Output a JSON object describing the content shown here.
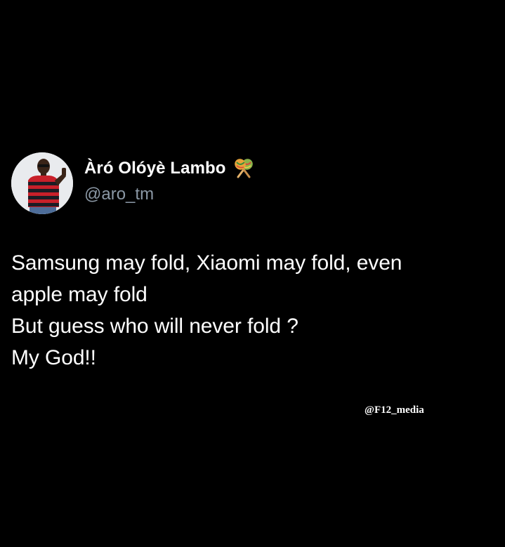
{
  "tweet": {
    "display_name": "Àró Olóyè Lambo",
    "name_emoji": "maracas-icon",
    "handle": "@aro_tm",
    "lines": [
      "Samsung may fold, Xiaomi may fold, even",
      "apple may fold",
      "But guess who will never fold ?",
      "My God!!"
    ]
  },
  "watermark": {
    "text": "@F12_media"
  },
  "colors": {
    "background": "#000000",
    "text": "#ffffff",
    "handle": "#8b98a5"
  }
}
